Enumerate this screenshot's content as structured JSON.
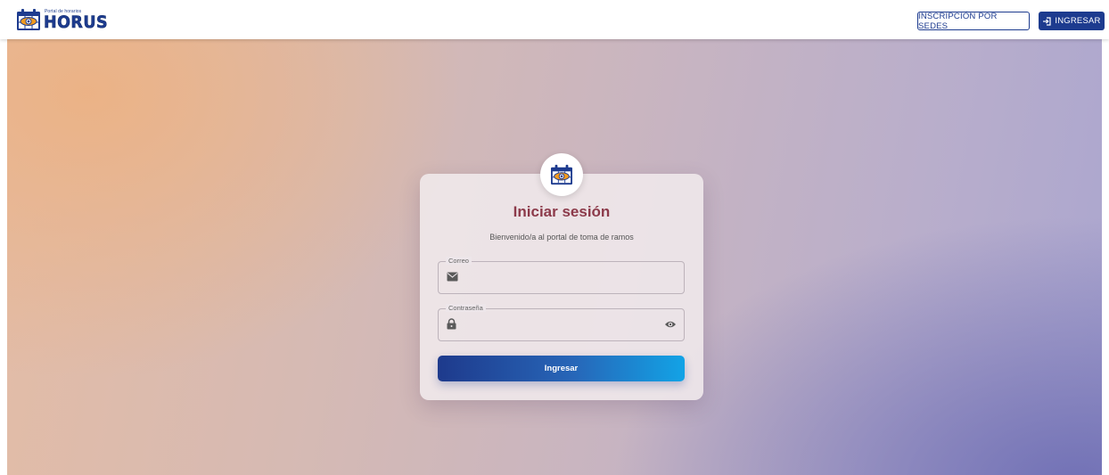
{
  "header": {
    "logo_small_text": "Portal de horarios",
    "logo_big_text": "HORUS",
    "sedes_label": "INSCRIPCIÓN POR SEDES",
    "ingresar_label": "INGRESAR"
  },
  "login": {
    "title": "Iniciar sesión",
    "subtitle": "Bienvenido/a al portal de toma de ramos",
    "email": {
      "label": "Correo",
      "value": "",
      "icon": "mail-icon"
    },
    "password": {
      "label": "Contraseña",
      "value": "",
      "icon": "lock-icon",
      "toggle_icon": "eye-icon"
    },
    "submit_label": "Ingresar"
  },
  "colors": {
    "brand_blue": "#1d3b8f",
    "title_color": "#8c3a4a",
    "button_gradient_start": "#1e3a8c",
    "button_gradient_end": "#12a3e6"
  }
}
